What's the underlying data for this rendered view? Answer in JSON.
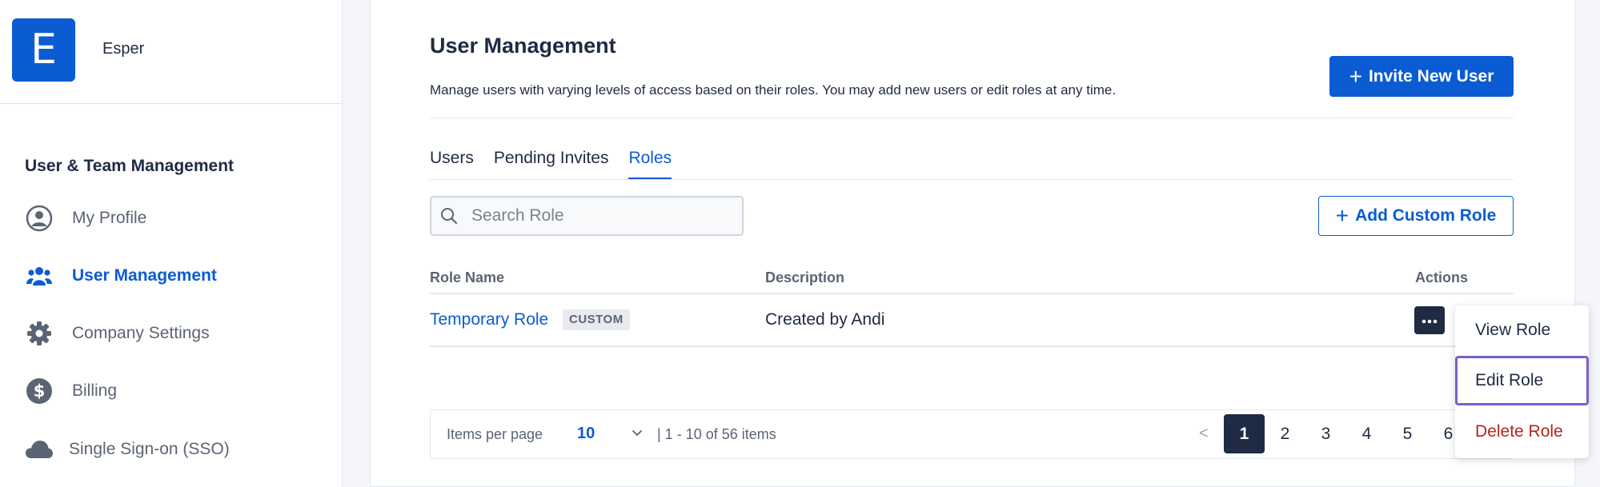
{
  "brand": {
    "logo_letter": "E",
    "name": "Esper"
  },
  "sidebar": {
    "section_title": "User & Team Management",
    "items": [
      {
        "label": "My Profile",
        "icon": "user-circle-icon",
        "active": false
      },
      {
        "label": "User Management",
        "icon": "users-icon",
        "active": true
      },
      {
        "label": "Company Settings",
        "icon": "gear-icon",
        "active": false
      },
      {
        "label": "Billing",
        "icon": "dollar-circle-icon",
        "active": false
      },
      {
        "label": "Single Sign-on (SSO)",
        "icon": "cloud-icon",
        "active": false
      }
    ]
  },
  "header": {
    "title": "User Management",
    "description": "Manage users with varying levels of access based on their roles. You may add new users or edit roles at any time.",
    "invite_label": "Invite New User"
  },
  "tabs": [
    {
      "label": "Users",
      "active": false
    },
    {
      "label": "Pending Invites",
      "active": false
    },
    {
      "label": "Roles",
      "active": true
    }
  ],
  "search": {
    "placeholder": "Search Role",
    "value": ""
  },
  "add_role_label": "Add Custom Role",
  "table": {
    "columns": [
      "Role Name",
      "Description",
      "Actions"
    ],
    "rows": [
      {
        "name": "Temporary Role",
        "badge": "CUSTOM",
        "description": "Created by Andi"
      }
    ]
  },
  "pagination": {
    "items_per_page_label": "Items per page",
    "items_per_page": "10",
    "range_text": "| 1 - 10 of 56 items",
    "prev": "<",
    "pages": [
      "1",
      "2",
      "3",
      "4",
      "5",
      "6"
    ],
    "current_page": "1"
  },
  "actions_menu": {
    "items": [
      "View Role",
      "Edit Role",
      "Delete Role"
    ],
    "focused": "Edit Role"
  },
  "colors": {
    "primary": "#0b5bd3",
    "dark": "#1f2a44",
    "danger": "#b3261e",
    "focus_ring": "#7b5fc9"
  }
}
